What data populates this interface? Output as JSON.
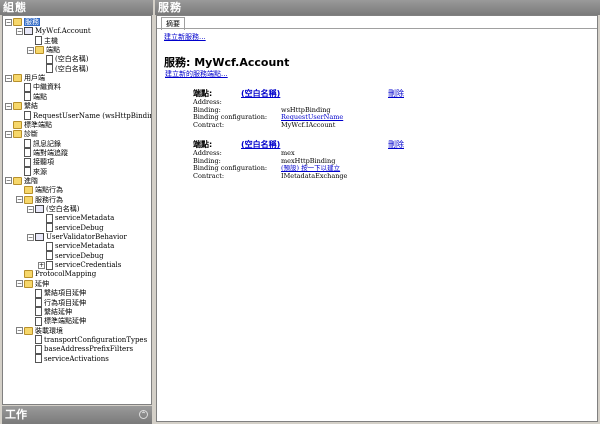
{
  "left_pane": {
    "title": "組態",
    "tasks_title": "工作",
    "tree": [
      {
        "label": "服務",
        "depth": 0,
        "icon": "folder",
        "exp": "−",
        "selected": true
      },
      {
        "label": "MyWcf.Account",
        "depth": 1,
        "icon": "service",
        "exp": "−"
      },
      {
        "label": "主機",
        "depth": 2,
        "icon": "doc"
      },
      {
        "label": "端點",
        "depth": 2,
        "icon": "folder",
        "exp": "−"
      },
      {
        "label": "(空白名稱)",
        "depth": 3,
        "icon": "doc"
      },
      {
        "label": "(空白名稱)",
        "depth": 3,
        "icon": "doc"
      },
      {
        "label": "用戶端",
        "depth": 0,
        "icon": "folder",
        "exp": "−"
      },
      {
        "label": "中繼資料",
        "depth": 1,
        "icon": "doc"
      },
      {
        "label": "端點",
        "depth": 1,
        "icon": "doc"
      },
      {
        "label": "繫結",
        "depth": 0,
        "icon": "folder",
        "exp": "−"
      },
      {
        "label": "RequestUserName (wsHttpBinding)",
        "depth": 1,
        "icon": "doc"
      },
      {
        "label": "標準端點",
        "depth": 0,
        "icon": "folder"
      },
      {
        "label": "診斷",
        "depth": 0,
        "icon": "folder",
        "exp": "−"
      },
      {
        "label": "訊息記錄",
        "depth": 1,
        "icon": "doc"
      },
      {
        "label": "端對端追蹤",
        "depth": 1,
        "icon": "doc"
      },
      {
        "label": "接聽項",
        "depth": 1,
        "icon": "doc"
      },
      {
        "label": "來源",
        "depth": 1,
        "icon": "doc"
      },
      {
        "label": "進階",
        "depth": 0,
        "icon": "folder",
        "exp": "−"
      },
      {
        "label": "端點行為",
        "depth": 1,
        "icon": "folder"
      },
      {
        "label": "服務行為",
        "depth": 1,
        "icon": "folder",
        "exp": "−"
      },
      {
        "label": "(空白名稱)",
        "depth": 2,
        "icon": "service",
        "exp": "−"
      },
      {
        "label": "serviceMetadata",
        "depth": 3,
        "icon": "doc"
      },
      {
        "label": "serviceDebug",
        "depth": 3,
        "icon": "doc"
      },
      {
        "label": "UserValidatorBehavior",
        "depth": 2,
        "icon": "service",
        "exp": "−"
      },
      {
        "label": "serviceMetadata",
        "depth": 3,
        "icon": "doc"
      },
      {
        "label": "serviceDebug",
        "depth": 3,
        "icon": "doc"
      },
      {
        "label": "serviceCredentials",
        "depth": 3,
        "icon": "doc",
        "exp": "+"
      },
      {
        "label": "ProtocolMapping",
        "depth": 1,
        "icon": "folder"
      },
      {
        "label": "延伸",
        "depth": 1,
        "icon": "folder",
        "exp": "−"
      },
      {
        "label": "繫結項目延伸",
        "depth": 2,
        "icon": "doc"
      },
      {
        "label": "行為項目延伸",
        "depth": 2,
        "icon": "doc"
      },
      {
        "label": "繫結延伸",
        "depth": 2,
        "icon": "doc"
      },
      {
        "label": "標準端點延伸",
        "depth": 2,
        "icon": "doc"
      },
      {
        "label": "裝載環境",
        "depth": 1,
        "icon": "folder",
        "exp": "−"
      },
      {
        "label": "transportConfigurationTypes",
        "depth": 2,
        "icon": "doc"
      },
      {
        "label": "baseAddressPrefixFilters",
        "depth": 2,
        "icon": "doc"
      },
      {
        "label": "serviceActivations",
        "depth": 2,
        "icon": "doc"
      }
    ]
  },
  "right_pane": {
    "title": "服務",
    "tab_label": "摘要",
    "new_service_link": "建立新服務...",
    "service_title": "服務: MyWcf.Account",
    "new_endpoint_link": "建立新的服務端點...",
    "endpoints": [
      {
        "heading": "端點:",
        "name": "(空白名稱)",
        "delete_label": "刪除",
        "rows": [
          {
            "key": "Address:",
            "value": "",
            "link": false
          },
          {
            "key": "Binding:",
            "value": "wsHttpBinding",
            "link": false
          },
          {
            "key": "Binding configuration:",
            "value": "RequestUserName",
            "link": true
          },
          {
            "key": "Contract:",
            "value": "MyWcf.IAccount",
            "link": false
          }
        ]
      },
      {
        "heading": "端點:",
        "name": "(空白名稱)",
        "delete_label": "刪除",
        "rows": [
          {
            "key": "Address:",
            "value": "mex",
            "link": false
          },
          {
            "key": "Binding:",
            "value": "mexHttpBinding",
            "link": false
          },
          {
            "key": "Binding configuration:",
            "value": "(預設) 按一下以建立",
            "link": true
          },
          {
            "key": "Contract:",
            "value": "IMetadataExchange",
            "link": false
          }
        ]
      }
    ]
  }
}
